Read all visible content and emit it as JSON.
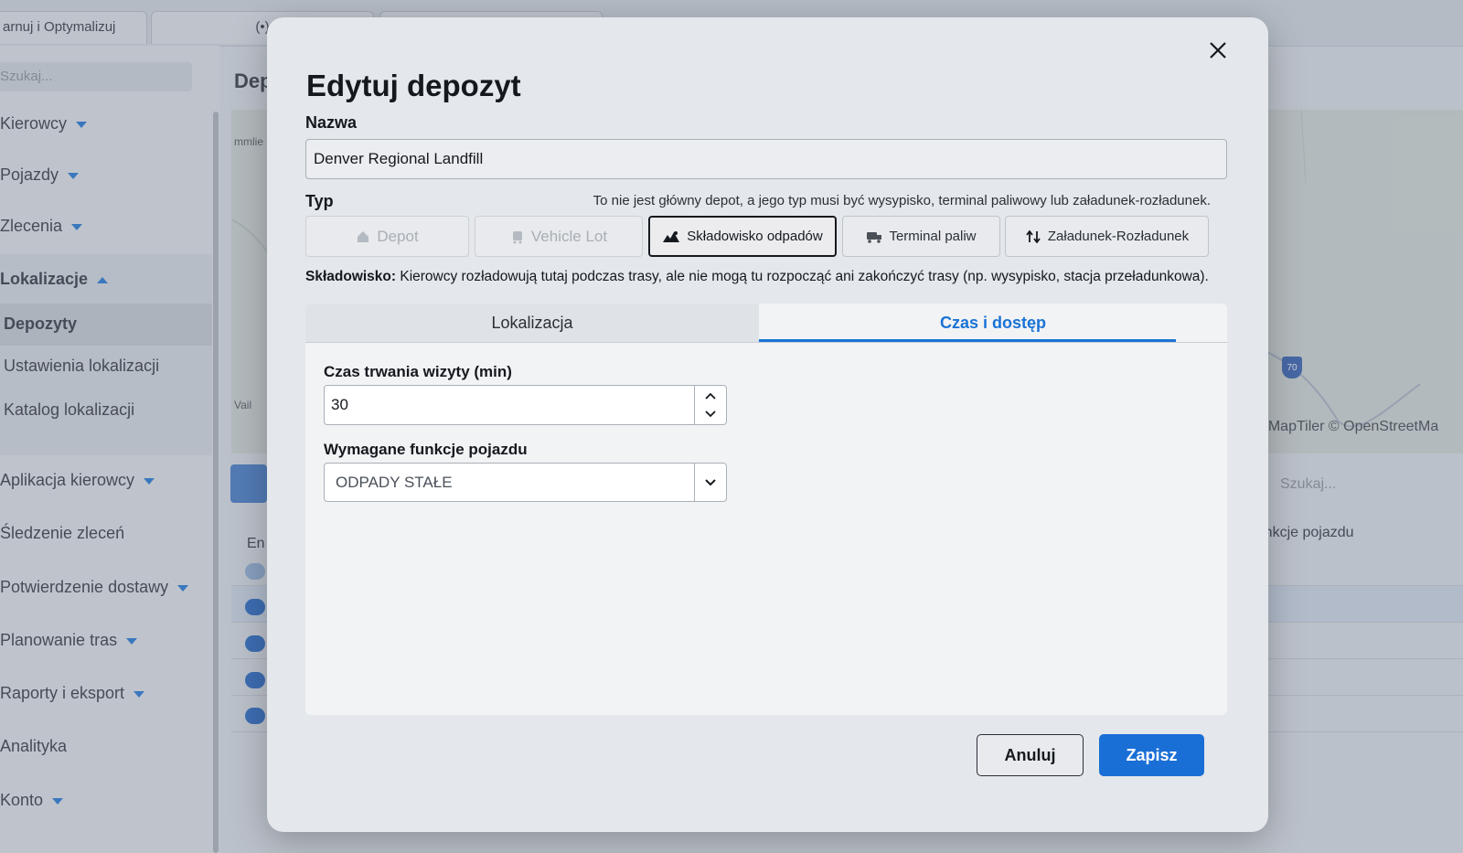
{
  "background": {
    "tabs": [
      {
        "label": "arnuj i Optymalizuj"
      },
      {
        "label": "(•)"
      }
    ],
    "sidebar_search_placeholder": "Szukaj...",
    "sidebar": {
      "kierowcy": "Kierowcy",
      "pojazdy": "Pojazdy",
      "zlecenia": "Zlecenia",
      "lokalizacje": "Lokalizacje",
      "depozyty": "Depozyty",
      "ustawienia": "Ustawienia lokalizacji",
      "katalog": "Katalog lokalizacji",
      "aplikacja": "Aplikacja kierowcy",
      "sledzenie": "Śledzenie zleceń",
      "potwierdzenie": "Potwierdzenie dostawy",
      "planowanie": "Planowanie tras",
      "raporty": "Raporty i eksport",
      "analityka": "Analityka",
      "konto": "Konto"
    },
    "main_title": "Dep",
    "map_labels": {
      "a": "mmlie",
      "b": "Vail",
      "shield": "70"
    },
    "map_attribution": "| © MapTiler © OpenStreetMa",
    "search_placeholder": "Szukaj...",
    "col_en": "En",
    "col_funkcje": "Funkcje pojazdu"
  },
  "modal": {
    "title": "Edytuj depozyt",
    "name_label": "Nazwa",
    "name_value": "Denver Regional Landfill",
    "type_label": "Typ",
    "type_hint": "To nie jest główny depot, a jego typ musi być wysypisko, terminal paliwowy lub załadunek-rozładunek.",
    "types": {
      "depot": "Depot",
      "vehicle_lot": "Vehicle Lot",
      "landfill": "Składowisko odpadów",
      "fuel": "Terminal paliw",
      "load": "Załadunek-Rozładunek"
    },
    "desc_bold": "Składowisko:",
    "desc_text": " Kierowcy rozładowują tutaj podczas trasy, ale nie mogą tu rozpocząć ani zakończyć trasy (np. wysypisko, stacja przeładunkowa).",
    "tabs": {
      "location": "Lokalizacja",
      "time": "Czas i dostęp"
    },
    "visit_label": "Czas trwania wizyty (min)",
    "visit_value": "30",
    "features_label": "Wymagane funkcje pojazdu",
    "features_value": "ODPADY STAŁE",
    "cancel": "Anuluj",
    "save": "Zapisz"
  },
  "colors": {
    "accent": "#1a6fd6",
    "overlay": "#7882914d"
  }
}
